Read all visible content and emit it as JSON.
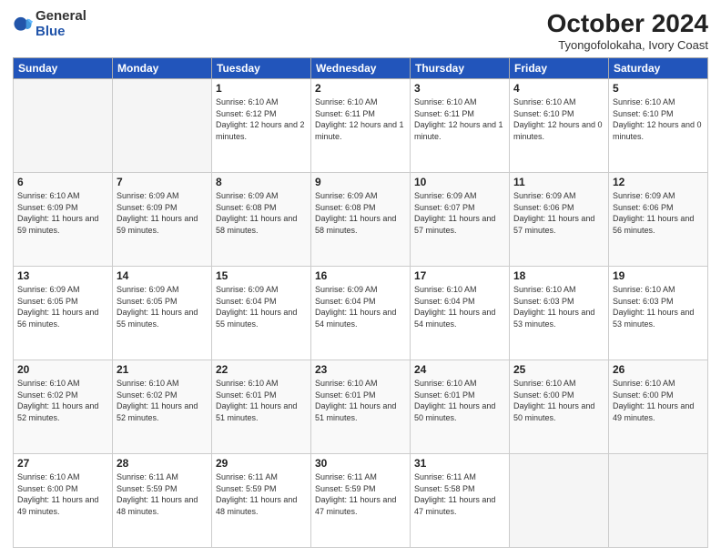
{
  "logo": {
    "general": "General",
    "blue": "Blue"
  },
  "title": "October 2024",
  "location": "Tyongofolokaha, Ivory Coast",
  "weekdays": [
    "Sunday",
    "Monday",
    "Tuesday",
    "Wednesday",
    "Thursday",
    "Friday",
    "Saturday"
  ],
  "weeks": [
    [
      {
        "day": "",
        "empty": true
      },
      {
        "day": "",
        "empty": true
      },
      {
        "day": "1",
        "sunrise": "6:10 AM",
        "sunset": "6:12 PM",
        "daylight": "12 hours and 2 minutes."
      },
      {
        "day": "2",
        "sunrise": "6:10 AM",
        "sunset": "6:11 PM",
        "daylight": "12 hours and 1 minute."
      },
      {
        "day": "3",
        "sunrise": "6:10 AM",
        "sunset": "6:11 PM",
        "daylight": "12 hours and 1 minute."
      },
      {
        "day": "4",
        "sunrise": "6:10 AM",
        "sunset": "6:10 PM",
        "daylight": "12 hours and 0 minutes."
      },
      {
        "day": "5",
        "sunrise": "6:10 AM",
        "sunset": "6:10 PM",
        "daylight": "12 hours and 0 minutes."
      }
    ],
    [
      {
        "day": "6",
        "sunrise": "6:10 AM",
        "sunset": "6:09 PM",
        "daylight": "11 hours and 59 minutes."
      },
      {
        "day": "7",
        "sunrise": "6:09 AM",
        "sunset": "6:09 PM",
        "daylight": "11 hours and 59 minutes."
      },
      {
        "day": "8",
        "sunrise": "6:09 AM",
        "sunset": "6:08 PM",
        "daylight": "11 hours and 58 minutes."
      },
      {
        "day": "9",
        "sunrise": "6:09 AM",
        "sunset": "6:08 PM",
        "daylight": "11 hours and 58 minutes."
      },
      {
        "day": "10",
        "sunrise": "6:09 AM",
        "sunset": "6:07 PM",
        "daylight": "11 hours and 57 minutes."
      },
      {
        "day": "11",
        "sunrise": "6:09 AM",
        "sunset": "6:06 PM",
        "daylight": "11 hours and 57 minutes."
      },
      {
        "day": "12",
        "sunrise": "6:09 AM",
        "sunset": "6:06 PM",
        "daylight": "11 hours and 56 minutes."
      }
    ],
    [
      {
        "day": "13",
        "sunrise": "6:09 AM",
        "sunset": "6:05 PM",
        "daylight": "11 hours and 56 minutes."
      },
      {
        "day": "14",
        "sunrise": "6:09 AM",
        "sunset": "6:05 PM",
        "daylight": "11 hours and 55 minutes."
      },
      {
        "day": "15",
        "sunrise": "6:09 AM",
        "sunset": "6:04 PM",
        "daylight": "11 hours and 55 minutes."
      },
      {
        "day": "16",
        "sunrise": "6:09 AM",
        "sunset": "6:04 PM",
        "daylight": "11 hours and 54 minutes."
      },
      {
        "day": "17",
        "sunrise": "6:10 AM",
        "sunset": "6:04 PM",
        "daylight": "11 hours and 54 minutes."
      },
      {
        "day": "18",
        "sunrise": "6:10 AM",
        "sunset": "6:03 PM",
        "daylight": "11 hours and 53 minutes."
      },
      {
        "day": "19",
        "sunrise": "6:10 AM",
        "sunset": "6:03 PM",
        "daylight": "11 hours and 53 minutes."
      }
    ],
    [
      {
        "day": "20",
        "sunrise": "6:10 AM",
        "sunset": "6:02 PM",
        "daylight": "11 hours and 52 minutes."
      },
      {
        "day": "21",
        "sunrise": "6:10 AM",
        "sunset": "6:02 PM",
        "daylight": "11 hours and 52 minutes."
      },
      {
        "day": "22",
        "sunrise": "6:10 AM",
        "sunset": "6:01 PM",
        "daylight": "11 hours and 51 minutes."
      },
      {
        "day": "23",
        "sunrise": "6:10 AM",
        "sunset": "6:01 PM",
        "daylight": "11 hours and 51 minutes."
      },
      {
        "day": "24",
        "sunrise": "6:10 AM",
        "sunset": "6:01 PM",
        "daylight": "11 hours and 50 minutes."
      },
      {
        "day": "25",
        "sunrise": "6:10 AM",
        "sunset": "6:00 PM",
        "daylight": "11 hours and 50 minutes."
      },
      {
        "day": "26",
        "sunrise": "6:10 AM",
        "sunset": "6:00 PM",
        "daylight": "11 hours and 49 minutes."
      }
    ],
    [
      {
        "day": "27",
        "sunrise": "6:10 AM",
        "sunset": "6:00 PM",
        "daylight": "11 hours and 49 minutes."
      },
      {
        "day": "28",
        "sunrise": "6:11 AM",
        "sunset": "5:59 PM",
        "daylight": "11 hours and 48 minutes."
      },
      {
        "day": "29",
        "sunrise": "6:11 AM",
        "sunset": "5:59 PM",
        "daylight": "11 hours and 48 minutes."
      },
      {
        "day": "30",
        "sunrise": "6:11 AM",
        "sunset": "5:59 PM",
        "daylight": "11 hours and 47 minutes."
      },
      {
        "day": "31",
        "sunrise": "6:11 AM",
        "sunset": "5:58 PM",
        "daylight": "11 hours and 47 minutes."
      },
      {
        "day": "",
        "empty": true
      },
      {
        "day": "",
        "empty": true
      }
    ]
  ],
  "labels": {
    "sunrise": "Sunrise:",
    "sunset": "Sunset:",
    "daylight": "Daylight:"
  }
}
